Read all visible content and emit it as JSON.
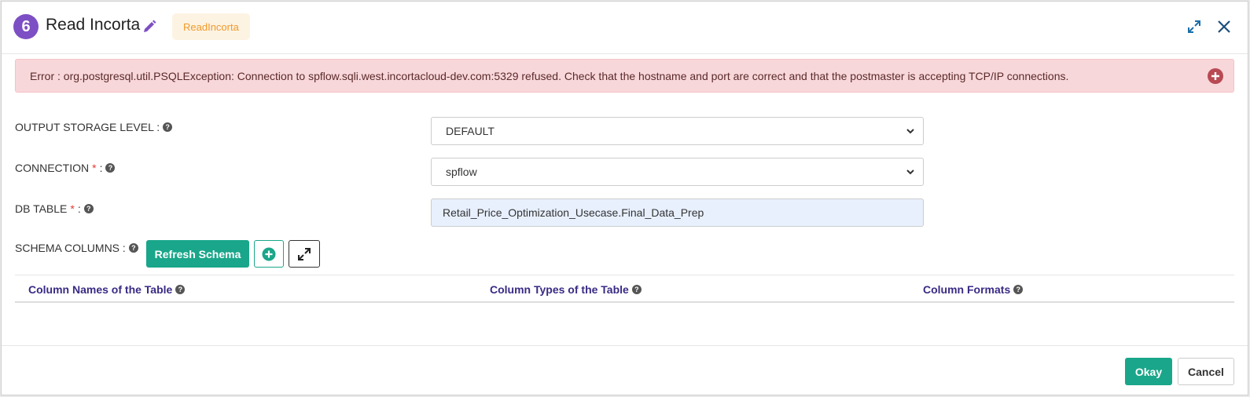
{
  "header": {
    "step_number": "6",
    "title": "Read Incorta",
    "type_tag": "ReadIncorta"
  },
  "error": {
    "message": "Error : org.postgresql.util.PSQLException: Connection to spflow.sqli.west.incortacloud-dev.com:5329 refused. Check that the hostname and port are correct and that the postmaster is accepting TCP/IP connections."
  },
  "form": {
    "output_storage_level": {
      "label": "OUTPUT STORAGE LEVEL :",
      "value": "DEFAULT"
    },
    "connection": {
      "label": "CONNECTION",
      "required": "*",
      "colon": ":",
      "value": "spflow"
    },
    "db_table": {
      "label": "DB TABLE",
      "required": "*",
      "colon": ":",
      "value": "Retail_Price_Optimization_Usecase.Final_Data_Prep"
    },
    "schema_columns": {
      "label": "SCHEMA COLUMNS :",
      "refresh_label": "Refresh Schema"
    }
  },
  "table": {
    "columns": [
      "Column Names of the Table",
      "Column Types of the Table",
      "Column Formats"
    ]
  },
  "footer": {
    "okay_label": "Okay",
    "cancel_label": "Cancel"
  },
  "colors": {
    "accent": "#1aa68a",
    "badge": "#7d4fc4",
    "error_bg": "#f8d7da",
    "column_header": "#3a2a85",
    "tag_text": "#f19a2a"
  },
  "icons": {
    "help": "?"
  }
}
